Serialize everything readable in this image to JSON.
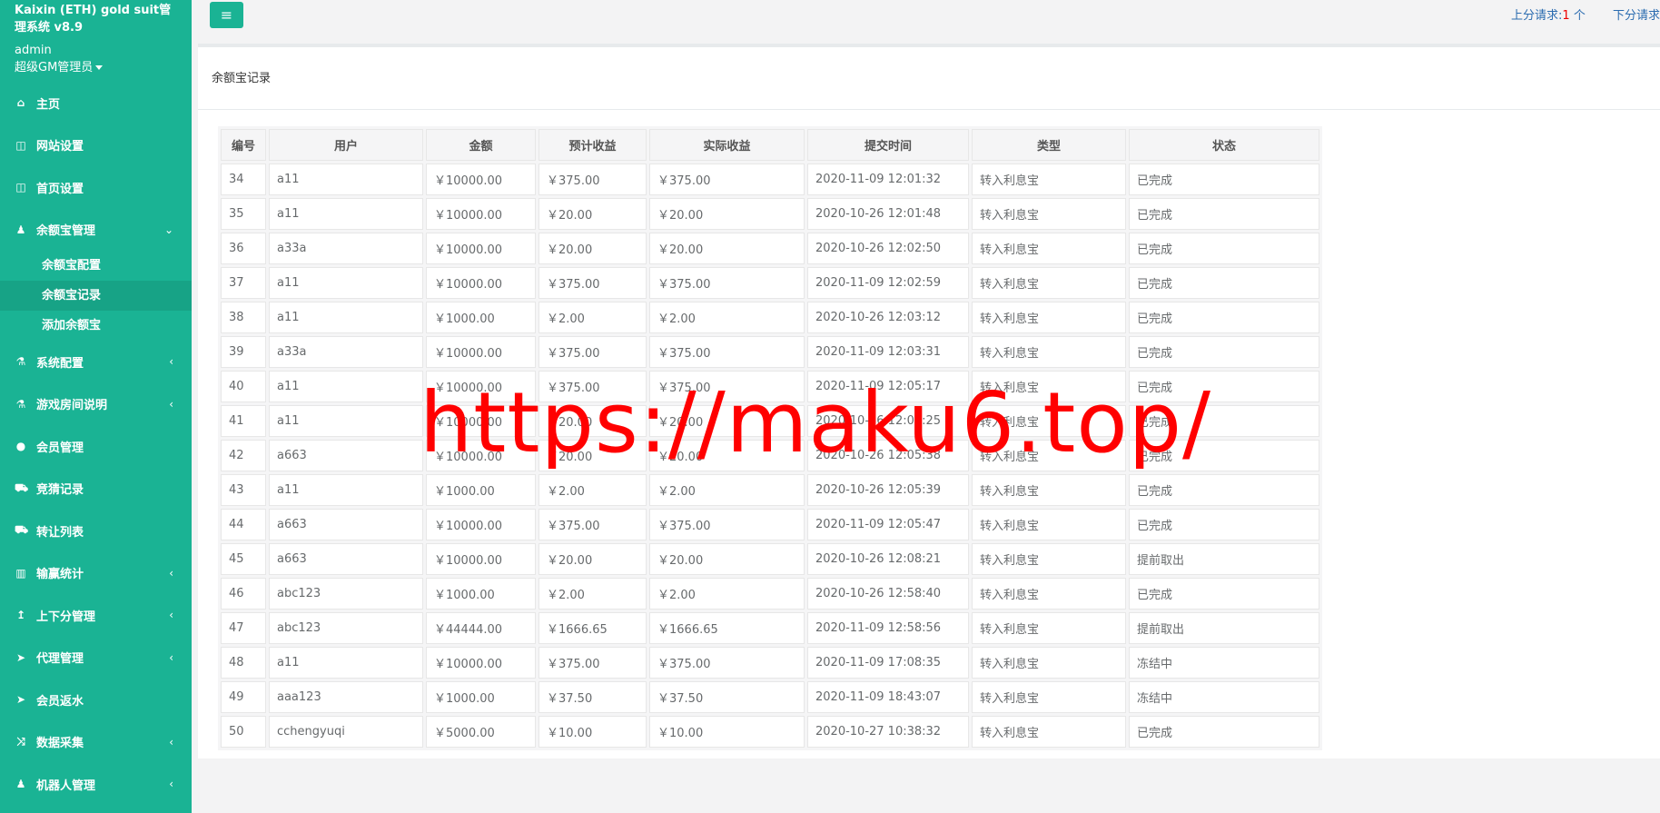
{
  "sidebar": {
    "brand": "Kaixin (ETH) gold suit管理系统 v8.9",
    "user": "admin",
    "role": "超级GM管理员",
    "items": [
      {
        "label": "主页",
        "icon": "home-icon",
        "glyph": "⌂",
        "arrow": ""
      },
      {
        "label": "网站设置",
        "icon": "columns-icon",
        "glyph": "◫",
        "arrow": ""
      },
      {
        "label": "首页设置",
        "icon": "columns-icon",
        "glyph": "◫",
        "arrow": ""
      },
      {
        "label": "余额宝管理",
        "icon": "person-icon",
        "glyph": "♟",
        "arrow": "⌄"
      },
      {
        "label": "系统配置",
        "icon": "flask-icon",
        "glyph": "⚗",
        "arrow": "‹"
      },
      {
        "label": "游戏房间说明",
        "icon": "flask-icon",
        "glyph": "⚗",
        "arrow": "‹"
      },
      {
        "label": "会员管理",
        "icon": "user-icon",
        "glyph": "●",
        "arrow": ""
      },
      {
        "label": "竞猜记录",
        "icon": "car-icon",
        "glyph": "⛟",
        "arrow": ""
      },
      {
        "label": "转让列表",
        "icon": "car-icon",
        "glyph": "⛟",
        "arrow": ""
      },
      {
        "label": "输赢统计",
        "icon": "bar-chart-icon",
        "glyph": "▥",
        "arrow": "‹"
      },
      {
        "label": "上下分管理",
        "icon": "level-up-icon",
        "glyph": "↥",
        "arrow": "‹"
      },
      {
        "label": "代理管理",
        "icon": "paper-plane-icon",
        "glyph": "➤",
        "arrow": "‹"
      },
      {
        "label": "会员返水",
        "icon": "paper-plane-icon",
        "glyph": "➤",
        "arrow": ""
      },
      {
        "label": "数据采集",
        "icon": "random-icon",
        "glyph": "⤨",
        "arrow": "‹"
      },
      {
        "label": "机器人管理",
        "icon": "person-icon",
        "glyph": "♟",
        "arrow": "‹"
      }
    ],
    "submenu": [
      "余额宝配置",
      "余额宝记录",
      "添加余额宝"
    ]
  },
  "topbar": {
    "menu_icon": "hamburger-icon",
    "menu_glyph": "≡",
    "up_label": "上分请求:",
    "up_count": "1",
    "up_unit": " 个",
    "down_label": "下分请求"
  },
  "panel": {
    "title": "余额宝记录"
  },
  "table": {
    "headers": [
      "编号",
      "用户",
      "金额",
      "预计收益",
      "实际收益",
      "提交时间",
      "类型",
      "状态"
    ],
    "rows": [
      [
        "34",
        "a11",
        "￥10000.00",
        "￥375.00",
        "￥375.00",
        "2020-11-09 12:01:32",
        "转入利息宝",
        "已完成"
      ],
      [
        "35",
        "a11",
        "￥10000.00",
        "￥20.00",
        "￥20.00",
        "2020-10-26 12:01:48",
        "转入利息宝",
        "已完成"
      ],
      [
        "36",
        "a33a",
        "￥10000.00",
        "￥20.00",
        "￥20.00",
        "2020-10-26 12:02:50",
        "转入利息宝",
        "已完成"
      ],
      [
        "37",
        "a11",
        "￥10000.00",
        "￥375.00",
        "￥375.00",
        "2020-11-09 12:02:59",
        "转入利息宝",
        "已完成"
      ],
      [
        "38",
        "a11",
        "￥1000.00",
        "￥2.00",
        "￥2.00",
        "2020-10-26 12:03:12",
        "转入利息宝",
        "已完成"
      ],
      [
        "39",
        "a33a",
        "￥10000.00",
        "￥375.00",
        "￥375.00",
        "2020-11-09 12:03:31",
        "转入利息宝",
        "已完成"
      ],
      [
        "40",
        "a11",
        "￥10000.00",
        "￥375.00",
        "￥375.00",
        "2020-11-09 12:05:17",
        "转入利息宝",
        "已完成"
      ],
      [
        "41",
        "a11",
        "￥10000.00",
        "￥20.00",
        "￥20.00",
        "2020-10-26 12:05:25",
        "转入利息宝",
        "已完成"
      ],
      [
        "42",
        "a663",
        "￥10000.00",
        "￥20.00",
        "￥20.00",
        "2020-10-26 12:05:38",
        "转入利息宝",
        "已完成"
      ],
      [
        "43",
        "a11",
        "￥1000.00",
        "￥2.00",
        "￥2.00",
        "2020-10-26 12:05:39",
        "转入利息宝",
        "已完成"
      ],
      [
        "44",
        "a663",
        "￥10000.00",
        "￥375.00",
        "￥375.00",
        "2020-11-09 12:05:47",
        "转入利息宝",
        "已完成"
      ],
      [
        "45",
        "a663",
        "￥10000.00",
        "￥20.00",
        "￥20.00",
        "2020-10-26 12:08:21",
        "转入利息宝",
        "提前取出"
      ],
      [
        "46",
        "abc123",
        "￥1000.00",
        "￥2.00",
        "￥2.00",
        "2020-10-26 12:58:40",
        "转入利息宝",
        "已完成"
      ],
      [
        "47",
        "abc123",
        "￥44444.00",
        "￥1666.65",
        "￥1666.65",
        "2020-11-09 12:58:56",
        "转入利息宝",
        "提前取出"
      ],
      [
        "48",
        "a11",
        "￥10000.00",
        "￥375.00",
        "￥375.00",
        "2020-11-09 17:08:35",
        "转入利息宝",
        "冻结中"
      ],
      [
        "49",
        "aaa123",
        "￥1000.00",
        "￥37.50",
        "￥37.50",
        "2020-11-09 18:43:07",
        "转入利息宝",
        "冻结中"
      ],
      [
        "50",
        "cchengyuqi",
        "￥5000.00",
        "￥10.00",
        "￥10.00",
        "2020-10-27 10:38:32",
        "转入利息宝",
        "已完成"
      ]
    ]
  },
  "watermark": "https://maku6.top/"
}
